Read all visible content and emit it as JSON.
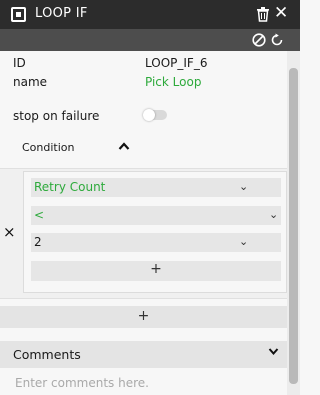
{
  "titlebar": {
    "title": "LOOP IF"
  },
  "fields": {
    "id_label": "ID",
    "id_value": "LOOP_IF_6",
    "name_label": "name",
    "name_value": "Pick Loop",
    "stop_on_failure_label": "stop on failure",
    "stop_on_failure_enabled": false
  },
  "condition": {
    "label": "Condition",
    "expanded": true,
    "operand_left": "Retry Count",
    "operator": "<",
    "operand_right": "2",
    "add_label": "+",
    "remove_label": "×"
  },
  "add_condition_label": "+",
  "comments": {
    "label": "Comments",
    "placeholder": "Enter comments here."
  },
  "colors": {
    "titlebar": "#2c2c2c",
    "toolbar": "#4d4d4d",
    "accent_green": "#2eaa3c"
  }
}
